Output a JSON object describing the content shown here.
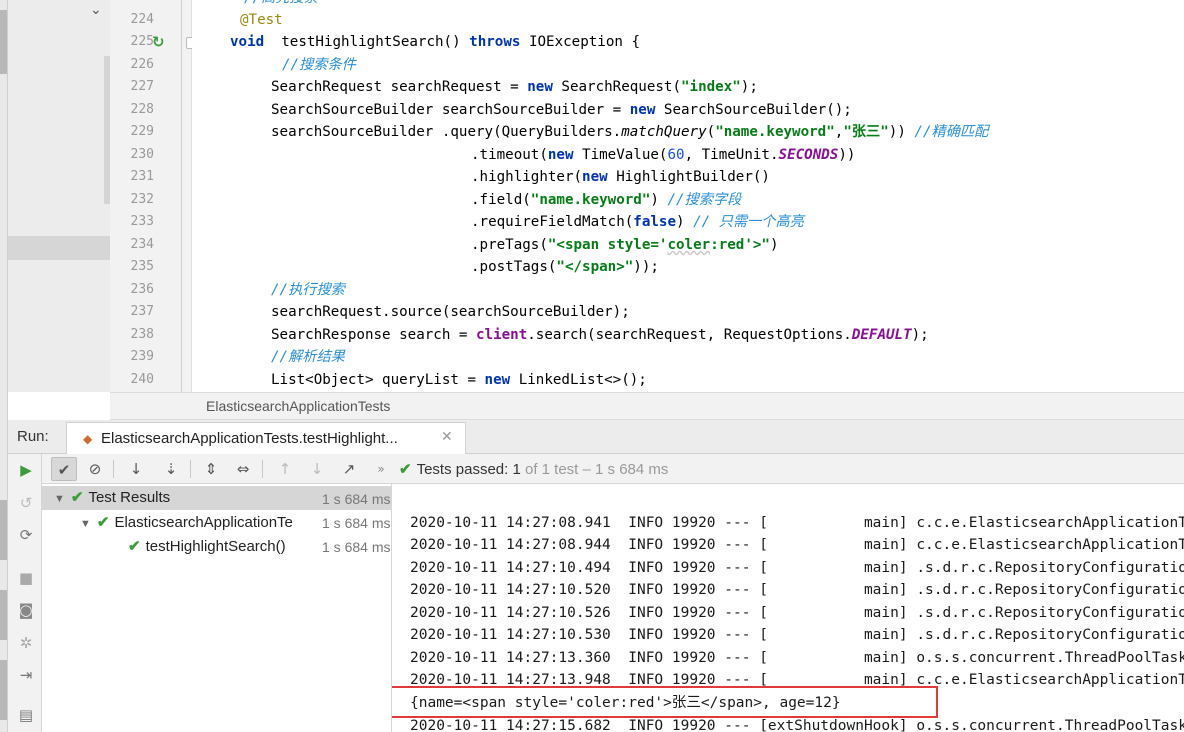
{
  "editor": {
    "line_numbers": [
      "224",
      "225",
      "226",
      "227",
      "228",
      "229",
      "230",
      "231",
      "232",
      "233",
      "234",
      "235",
      "236",
      "237",
      "238",
      "239",
      "240"
    ],
    "top_partial": "//高亮搜索",
    "code": {
      "l224": "@Test",
      "l225_kw1": "void",
      "l225_name": "  testHighlightSearch() ",
      "l225_kw2": "throws",
      "l225_rest": " IOException {",
      "l226": "//搜索条件",
      "l227_a": "SearchRequest searchRequest = ",
      "l227_kw": "new",
      "l227_b": " SearchRequest(",
      "l227_str": "\"index\"",
      "l227_c": ");",
      "l228_a": "SearchSourceBuilder searchSourceBuilder = ",
      "l228_kw": "new",
      "l228_b": " SearchSourceBuilder();",
      "l229_a": "searchSourceBuilder .query(QueryBuilders.",
      "l229_it": "matchQuery",
      "l229_b": "(",
      "l229_s1": "\"name.keyword\"",
      "l229_c": ",",
      "l229_s2": "\"张三\"",
      "l229_d": ")) ",
      "l229_cm": "//精确匹配",
      "l230_a": ".timeout(",
      "l230_kw": "new",
      "l230_b": " TimeValue(",
      "l230_num": "60",
      "l230_c": ", TimeUnit.",
      "l230_cn": "SECONDS",
      "l230_d": "))",
      "l231_a": ".highlighter(",
      "l231_kw": "new",
      "l231_b": " HighlightBuilder()",
      "l232_a": ".field(",
      "l232_str": "\"name.keyword\"",
      "l232_b": ") ",
      "l232_cm": "//搜索字段",
      "l233_a": ".requireFieldMatch(",
      "l233_kw": "false",
      "l233_b": ") ",
      "l233_cm": "// 只需一个高亮",
      "l234_a": ".preTags(",
      "l234_s1": "\"<span style='",
      "l234_s2": "coler",
      "l234_s3": ":red'>\"",
      "l234_b": ")",
      "l235_a": ".postTags(",
      "l235_str": "\"</span>\"",
      "l235_b": "));",
      "l236": "//执行搜索",
      "l237": "searchRequest.source(searchSourceBuilder);",
      "l238_a": "SearchResponse search = ",
      "l238_kw": "client",
      "l238_b": ".search(searchRequest, RequestOptions.",
      "l238_cn": "DEFAULT",
      "l238_c": ");",
      "l239": "//解析结果",
      "l240_a": "List<Object> queryList = ",
      "l240_kw": "new",
      "l240_b": " LinkedList<>();"
    }
  },
  "breadcrumb": "ElasticsearchApplicationTests",
  "run": {
    "label": "Run:",
    "tab_title": "ElasticsearchApplicationTests.testHighlight...",
    "status_prefix": "Tests passed: ",
    "status_passed": "1",
    "status_rest": " of 1 test – 1 s 684 ms"
  },
  "tests": {
    "root": {
      "label": "Test Results",
      "time": "1 s 684 ms"
    },
    "class": {
      "label": "ElasticsearchApplicationTe",
      "time": "1 s 684 ms"
    },
    "method": {
      "label": "testHighlightSearch()",
      "time": "1 s 684 ms"
    }
  },
  "console": {
    "lines": [
      "2020-10-11 14:27:08.941  INFO 19920 --- [           main] c.c.e.ElasticsearchApplicationTests",
      "2020-10-11 14:27:08.944  INFO 19920 --- [           main] c.c.e.ElasticsearchApplicationTests",
      "2020-10-11 14:27:10.494  INFO 19920 --- [           main] .s.d.r.c.RepositoryConfigurationDelegate",
      "2020-10-11 14:27:10.520  INFO 19920 --- [           main] .s.d.r.c.RepositoryConfigurationDelegate",
      "2020-10-11 14:27:10.526  INFO 19920 --- [           main] .s.d.r.c.RepositoryConfigurationDelegate",
      "2020-10-11 14:27:10.530  INFO 19920 --- [           main] .s.d.r.c.RepositoryConfigurationDelegate",
      "2020-10-11 14:27:13.360  INFO 19920 --- [           main] o.s.s.concurrent.ThreadPoolTaskExecutor",
      "2020-10-11 14:27:13.948  INFO 19920 --- [           main] c.c.e.ElasticsearchApplicationTests",
      "{name=<span style='coler:red'>张三</span>, age=12}",
      "2020-10-11 14:27:15.682  INFO 19920 --- [extShutdownHook] o.s.s.concurrent.ThreadPoolTaskExecutor"
    ]
  },
  "colors": {
    "highlight_box": "#e23a3a",
    "pass_green": "#3d9a3d",
    "keyword": "#0033b3",
    "string": "#067d17"
  }
}
